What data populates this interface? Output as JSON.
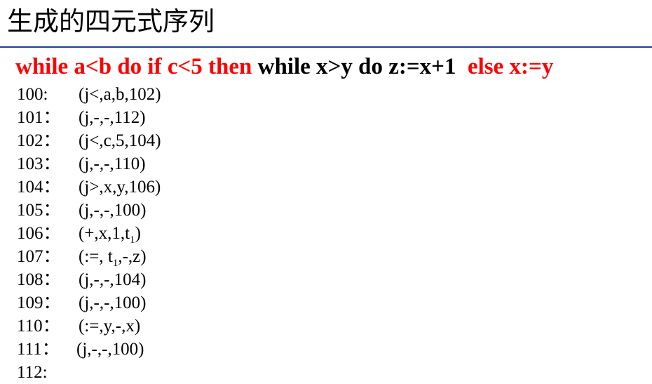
{
  "slide": {
    "title": "生成的四元式序列"
  },
  "statement": {
    "segments": [
      {
        "text": "while a<b do if c<5 then ",
        "color": "#ff0000"
      },
      {
        "text": "while x>y do z:=x+1  ",
        "color": "#000000"
      },
      {
        "text": "else x:=y",
        "color": "#ff0000"
      }
    ]
  },
  "quadruples": [
    {
      "addr": "100:",
      "parts": [
        "(j<,a,b,102)"
      ]
    },
    {
      "addr": "101：",
      "parts": [
        "(j,-,-,112)"
      ]
    },
    {
      "addr": "102：",
      "parts": [
        "(j<,c,5,104)"
      ]
    },
    {
      "addr": "103：",
      "parts": [
        "(j,-,-,110)"
      ]
    },
    {
      "addr": "104：",
      "parts": [
        "(j>,x,y,106)"
      ]
    },
    {
      "addr": "105：",
      "parts": [
        "(j,-,-,100)"
      ]
    },
    {
      "addr": "106：",
      "parts": [
        "(+,x,1,t",
        "1",
        ")"
      ]
    },
    {
      "addr": "107：",
      "parts": [
        "(:=, t",
        "1",
        ",-,z)"
      ]
    },
    {
      "addr": "108：",
      "parts": [
        "(j,-,-,104)"
      ]
    },
    {
      "addr": "109：",
      "parts": [
        "(j,-,-,100)"
      ]
    },
    {
      "addr": "110：",
      "parts": [
        "(:=,y,-,x)"
      ]
    },
    {
      "addr": "111：",
      "parts": [
        "(j,-,-,100)"
      ]
    },
    {
      "addr": "112:",
      "parts": []
    }
  ]
}
